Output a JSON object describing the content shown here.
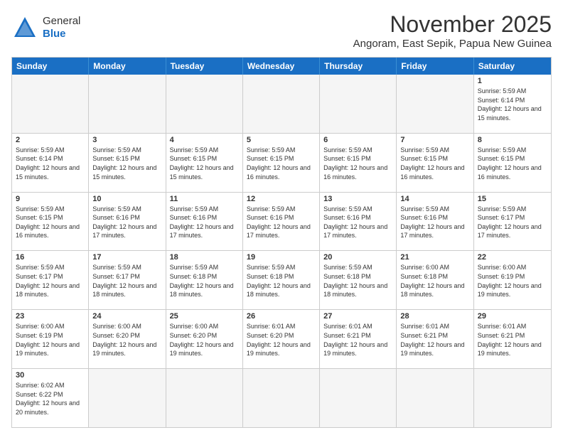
{
  "header": {
    "logo_general": "General",
    "logo_blue": "Blue",
    "month_title": "November 2025",
    "location": "Angoram, East Sepik, Papua New Guinea"
  },
  "days_of_week": [
    "Sunday",
    "Monday",
    "Tuesday",
    "Wednesday",
    "Thursday",
    "Friday",
    "Saturday"
  ],
  "weeks": [
    [
      {
        "day": "",
        "info": ""
      },
      {
        "day": "",
        "info": ""
      },
      {
        "day": "",
        "info": ""
      },
      {
        "day": "",
        "info": ""
      },
      {
        "day": "",
        "info": ""
      },
      {
        "day": "",
        "info": ""
      },
      {
        "day": "1",
        "info": "Sunrise: 5:59 AM\nSunset: 6:14 PM\nDaylight: 12 hours and 15 minutes."
      }
    ],
    [
      {
        "day": "2",
        "info": "Sunrise: 5:59 AM\nSunset: 6:14 PM\nDaylight: 12 hours and 15 minutes."
      },
      {
        "day": "3",
        "info": "Sunrise: 5:59 AM\nSunset: 6:15 PM\nDaylight: 12 hours and 15 minutes."
      },
      {
        "day": "4",
        "info": "Sunrise: 5:59 AM\nSunset: 6:15 PM\nDaylight: 12 hours and 15 minutes."
      },
      {
        "day": "5",
        "info": "Sunrise: 5:59 AM\nSunset: 6:15 PM\nDaylight: 12 hours and 16 minutes."
      },
      {
        "day": "6",
        "info": "Sunrise: 5:59 AM\nSunset: 6:15 PM\nDaylight: 12 hours and 16 minutes."
      },
      {
        "day": "7",
        "info": "Sunrise: 5:59 AM\nSunset: 6:15 PM\nDaylight: 12 hours and 16 minutes."
      },
      {
        "day": "8",
        "info": "Sunrise: 5:59 AM\nSunset: 6:15 PM\nDaylight: 12 hours and 16 minutes."
      }
    ],
    [
      {
        "day": "9",
        "info": "Sunrise: 5:59 AM\nSunset: 6:15 PM\nDaylight: 12 hours and 16 minutes."
      },
      {
        "day": "10",
        "info": "Sunrise: 5:59 AM\nSunset: 6:16 PM\nDaylight: 12 hours and 17 minutes."
      },
      {
        "day": "11",
        "info": "Sunrise: 5:59 AM\nSunset: 6:16 PM\nDaylight: 12 hours and 17 minutes."
      },
      {
        "day": "12",
        "info": "Sunrise: 5:59 AM\nSunset: 6:16 PM\nDaylight: 12 hours and 17 minutes."
      },
      {
        "day": "13",
        "info": "Sunrise: 5:59 AM\nSunset: 6:16 PM\nDaylight: 12 hours and 17 minutes."
      },
      {
        "day": "14",
        "info": "Sunrise: 5:59 AM\nSunset: 6:16 PM\nDaylight: 12 hours and 17 minutes."
      },
      {
        "day": "15",
        "info": "Sunrise: 5:59 AM\nSunset: 6:17 PM\nDaylight: 12 hours and 17 minutes."
      }
    ],
    [
      {
        "day": "16",
        "info": "Sunrise: 5:59 AM\nSunset: 6:17 PM\nDaylight: 12 hours and 18 minutes."
      },
      {
        "day": "17",
        "info": "Sunrise: 5:59 AM\nSunset: 6:17 PM\nDaylight: 12 hours and 18 minutes."
      },
      {
        "day": "18",
        "info": "Sunrise: 5:59 AM\nSunset: 6:18 PM\nDaylight: 12 hours and 18 minutes."
      },
      {
        "day": "19",
        "info": "Sunrise: 5:59 AM\nSunset: 6:18 PM\nDaylight: 12 hours and 18 minutes."
      },
      {
        "day": "20",
        "info": "Sunrise: 5:59 AM\nSunset: 6:18 PM\nDaylight: 12 hours and 18 minutes."
      },
      {
        "day": "21",
        "info": "Sunrise: 6:00 AM\nSunset: 6:18 PM\nDaylight: 12 hours and 18 minutes."
      },
      {
        "day": "22",
        "info": "Sunrise: 6:00 AM\nSunset: 6:19 PM\nDaylight: 12 hours and 19 minutes."
      }
    ],
    [
      {
        "day": "23",
        "info": "Sunrise: 6:00 AM\nSunset: 6:19 PM\nDaylight: 12 hours and 19 minutes."
      },
      {
        "day": "24",
        "info": "Sunrise: 6:00 AM\nSunset: 6:20 PM\nDaylight: 12 hours and 19 minutes."
      },
      {
        "day": "25",
        "info": "Sunrise: 6:00 AM\nSunset: 6:20 PM\nDaylight: 12 hours and 19 minutes."
      },
      {
        "day": "26",
        "info": "Sunrise: 6:01 AM\nSunset: 6:20 PM\nDaylight: 12 hours and 19 minutes."
      },
      {
        "day": "27",
        "info": "Sunrise: 6:01 AM\nSunset: 6:21 PM\nDaylight: 12 hours and 19 minutes."
      },
      {
        "day": "28",
        "info": "Sunrise: 6:01 AM\nSunset: 6:21 PM\nDaylight: 12 hours and 19 minutes."
      },
      {
        "day": "29",
        "info": "Sunrise: 6:01 AM\nSunset: 6:21 PM\nDaylight: 12 hours and 19 minutes."
      }
    ],
    [
      {
        "day": "30",
        "info": "Sunrise: 6:02 AM\nSunset: 6:22 PM\nDaylight: 12 hours and 20 minutes."
      },
      {
        "day": "",
        "info": ""
      },
      {
        "day": "",
        "info": ""
      },
      {
        "day": "",
        "info": ""
      },
      {
        "day": "",
        "info": ""
      },
      {
        "day": "",
        "info": ""
      },
      {
        "day": "",
        "info": ""
      }
    ]
  ]
}
